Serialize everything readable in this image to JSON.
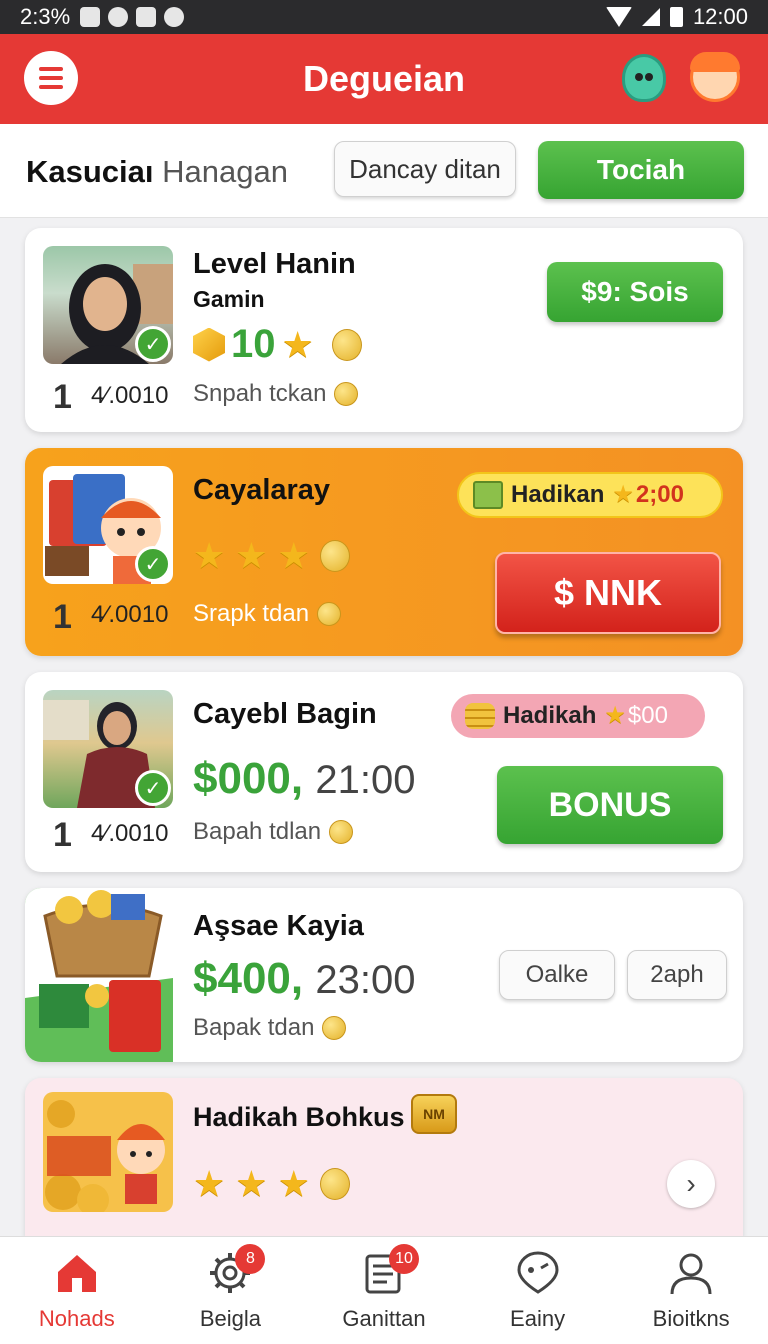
{
  "status_bar": {
    "time_left": "2:3%",
    "time_right": "12:00"
  },
  "header": {
    "title": "Degueian"
  },
  "subheader": {
    "title_bold": "Kasuciaı",
    "title_light": "Hanagan",
    "outline_button": "Dancay ditan",
    "primary_button": "Tociah"
  },
  "cards": [
    {
      "name": "Level Hanin",
      "subtitle": "Gamin",
      "rating_value": "10",
      "rank": "1",
      "rank_value": "4⁄.0010",
      "meta": "Snpah tckan",
      "button": "$9: Sois"
    },
    {
      "name": "Cayalaray",
      "rank": "1",
      "rank_value": "4⁄.0010",
      "meta": "Srapk tdan",
      "pill": "Hadikan",
      "pill_value": "2;00",
      "button": "$ NNK",
      "stars": 3
    },
    {
      "name": "Cayebl Bagin",
      "money_green": "$000,",
      "money_grey": "21:00",
      "rank": "1",
      "rank_value": "4⁄.0010",
      "meta": "Bapah tdlan",
      "pill": "Hadikah",
      "pill_value": "$00",
      "button": "BONUS"
    },
    {
      "name": "Aşsae Kayia",
      "money_green": "$400,",
      "money_grey": "23:00",
      "meta": "Bapak tdan",
      "button_a": "Oalke",
      "button_b": "2aph"
    },
    {
      "name": "Hadikah Bohkus",
      "coin_label": "NM",
      "stars": 3
    }
  ],
  "nav": [
    {
      "label": "Nohads",
      "icon": "home-icon",
      "active": true
    },
    {
      "label": "Beigla",
      "icon": "gear-icon",
      "badge": "8"
    },
    {
      "label": "Ganittan",
      "icon": "list-icon",
      "badge": "10"
    },
    {
      "label": "Eainy",
      "icon": "face-icon"
    },
    {
      "label": "Bioitkns",
      "icon": "profile-icon"
    }
  ],
  "colors": {
    "brand_red": "#e53935",
    "green": "#3aa33a",
    "orange": "#f59a23",
    "pink_card": "#fbe9ee"
  }
}
